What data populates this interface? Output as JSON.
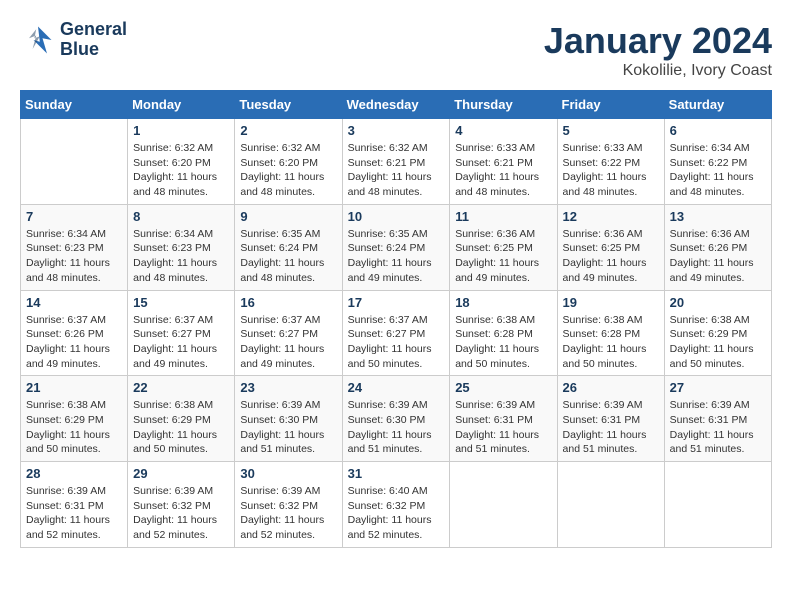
{
  "header": {
    "logo_line1": "General",
    "logo_line2": "Blue",
    "month_title": "January 2024",
    "location": "Kokolilie, Ivory Coast"
  },
  "days_of_week": [
    "Sunday",
    "Monday",
    "Tuesday",
    "Wednesday",
    "Thursday",
    "Friday",
    "Saturday"
  ],
  "weeks": [
    [
      {
        "day": "",
        "info": ""
      },
      {
        "day": "1",
        "info": "Sunrise: 6:32 AM\nSunset: 6:20 PM\nDaylight: 11 hours and 48 minutes."
      },
      {
        "day": "2",
        "info": "Sunrise: 6:32 AM\nSunset: 6:20 PM\nDaylight: 11 hours and 48 minutes."
      },
      {
        "day": "3",
        "info": "Sunrise: 6:32 AM\nSunset: 6:21 PM\nDaylight: 11 hours and 48 minutes."
      },
      {
        "day": "4",
        "info": "Sunrise: 6:33 AM\nSunset: 6:21 PM\nDaylight: 11 hours and 48 minutes."
      },
      {
        "day": "5",
        "info": "Sunrise: 6:33 AM\nSunset: 6:22 PM\nDaylight: 11 hours and 48 minutes."
      },
      {
        "day": "6",
        "info": "Sunrise: 6:34 AM\nSunset: 6:22 PM\nDaylight: 11 hours and 48 minutes."
      }
    ],
    [
      {
        "day": "7",
        "info": "Sunrise: 6:34 AM\nSunset: 6:23 PM\nDaylight: 11 hours and 48 minutes."
      },
      {
        "day": "8",
        "info": "Sunrise: 6:34 AM\nSunset: 6:23 PM\nDaylight: 11 hours and 48 minutes."
      },
      {
        "day": "9",
        "info": "Sunrise: 6:35 AM\nSunset: 6:24 PM\nDaylight: 11 hours and 48 minutes."
      },
      {
        "day": "10",
        "info": "Sunrise: 6:35 AM\nSunset: 6:24 PM\nDaylight: 11 hours and 49 minutes."
      },
      {
        "day": "11",
        "info": "Sunrise: 6:36 AM\nSunset: 6:25 PM\nDaylight: 11 hours and 49 minutes."
      },
      {
        "day": "12",
        "info": "Sunrise: 6:36 AM\nSunset: 6:25 PM\nDaylight: 11 hours and 49 minutes."
      },
      {
        "day": "13",
        "info": "Sunrise: 6:36 AM\nSunset: 6:26 PM\nDaylight: 11 hours and 49 minutes."
      }
    ],
    [
      {
        "day": "14",
        "info": "Sunrise: 6:37 AM\nSunset: 6:26 PM\nDaylight: 11 hours and 49 minutes."
      },
      {
        "day": "15",
        "info": "Sunrise: 6:37 AM\nSunset: 6:27 PM\nDaylight: 11 hours and 49 minutes."
      },
      {
        "day": "16",
        "info": "Sunrise: 6:37 AM\nSunset: 6:27 PM\nDaylight: 11 hours and 49 minutes."
      },
      {
        "day": "17",
        "info": "Sunrise: 6:37 AM\nSunset: 6:27 PM\nDaylight: 11 hours and 50 minutes."
      },
      {
        "day": "18",
        "info": "Sunrise: 6:38 AM\nSunset: 6:28 PM\nDaylight: 11 hours and 50 minutes."
      },
      {
        "day": "19",
        "info": "Sunrise: 6:38 AM\nSunset: 6:28 PM\nDaylight: 11 hours and 50 minutes."
      },
      {
        "day": "20",
        "info": "Sunrise: 6:38 AM\nSunset: 6:29 PM\nDaylight: 11 hours and 50 minutes."
      }
    ],
    [
      {
        "day": "21",
        "info": "Sunrise: 6:38 AM\nSunset: 6:29 PM\nDaylight: 11 hours and 50 minutes."
      },
      {
        "day": "22",
        "info": "Sunrise: 6:38 AM\nSunset: 6:29 PM\nDaylight: 11 hours and 50 minutes."
      },
      {
        "day": "23",
        "info": "Sunrise: 6:39 AM\nSunset: 6:30 PM\nDaylight: 11 hours and 51 minutes."
      },
      {
        "day": "24",
        "info": "Sunrise: 6:39 AM\nSunset: 6:30 PM\nDaylight: 11 hours and 51 minutes."
      },
      {
        "day": "25",
        "info": "Sunrise: 6:39 AM\nSunset: 6:31 PM\nDaylight: 11 hours and 51 minutes."
      },
      {
        "day": "26",
        "info": "Sunrise: 6:39 AM\nSunset: 6:31 PM\nDaylight: 11 hours and 51 minutes."
      },
      {
        "day": "27",
        "info": "Sunrise: 6:39 AM\nSunset: 6:31 PM\nDaylight: 11 hours and 51 minutes."
      }
    ],
    [
      {
        "day": "28",
        "info": "Sunrise: 6:39 AM\nSunset: 6:31 PM\nDaylight: 11 hours and 52 minutes."
      },
      {
        "day": "29",
        "info": "Sunrise: 6:39 AM\nSunset: 6:32 PM\nDaylight: 11 hours and 52 minutes."
      },
      {
        "day": "30",
        "info": "Sunrise: 6:39 AM\nSunset: 6:32 PM\nDaylight: 11 hours and 52 minutes."
      },
      {
        "day": "31",
        "info": "Sunrise: 6:40 AM\nSunset: 6:32 PM\nDaylight: 11 hours and 52 minutes."
      },
      {
        "day": "",
        "info": ""
      },
      {
        "day": "",
        "info": ""
      },
      {
        "day": "",
        "info": ""
      }
    ]
  ]
}
